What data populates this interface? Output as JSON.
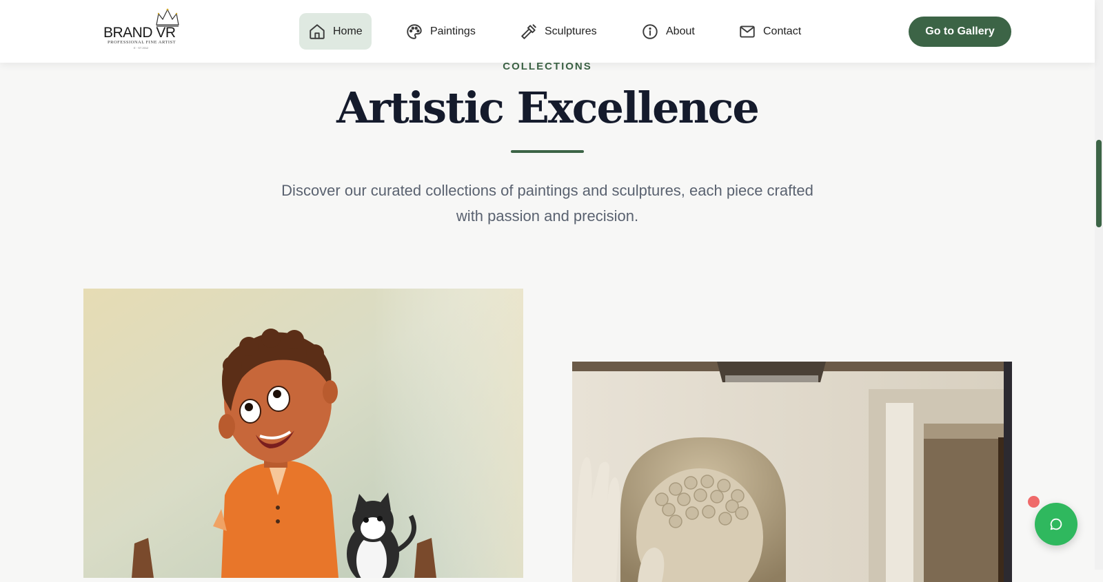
{
  "brand": {
    "name": "BRAND VR",
    "tagline": "PROFESSIONAL FINE ARTIST",
    "sub_tagline": "E · ST 2012"
  },
  "nav": {
    "items": [
      {
        "label": "Home",
        "icon": "home-icon",
        "active": true
      },
      {
        "label": "Paintings",
        "icon": "palette-icon",
        "active": false
      },
      {
        "label": "Sculptures",
        "icon": "chisel-icon",
        "active": false
      },
      {
        "label": "About",
        "icon": "info-icon",
        "active": false
      },
      {
        "label": "Contact",
        "icon": "mail-icon",
        "active": false
      }
    ],
    "cta_label": "Go to Gallery"
  },
  "section": {
    "eyebrow": "COLLECTIONS",
    "title": "Artistic Excellence",
    "description": "Discover our curated collections of paintings and sculptures, each piece crafted with passion and precision."
  },
  "collections": [
    {
      "type": "painting",
      "image_subject": "cartoon-boy-with-cat"
    },
    {
      "type": "sculpture",
      "image_subject": "buddha-head-sculpture"
    }
  ],
  "chat": {
    "icon": "chat-bubble-icon",
    "has_notification": true
  },
  "colors": {
    "accent": "#3c6446",
    "active_nav_bg": "#dfe9e1",
    "title": "#151b2c",
    "chat": "#2fb85e",
    "notification": "#ef6a6a"
  }
}
